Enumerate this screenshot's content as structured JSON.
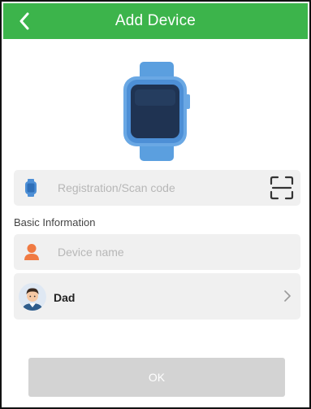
{
  "header": {
    "title": "Add Device",
    "back_icon": "chevron-left-icon",
    "color": "#3cb44b"
  },
  "illustration": {
    "icon": "smartwatch-icon"
  },
  "registration": {
    "placeholder": "Registration/Scan code",
    "value": "",
    "scan_icon": "scan-frame-icon",
    "watch_icon": "watch-icon"
  },
  "basic_info": {
    "label": "Basic Information",
    "device_name": {
      "placeholder": "Device name",
      "value": "",
      "icon": "person-icon"
    },
    "relation": {
      "name": "Dad",
      "avatar_icon": "avatar-icon",
      "chevron_icon": "chevron-right-icon"
    }
  },
  "ok_button": {
    "label": "OK",
    "disabled": true,
    "color": "#d3d3d3"
  }
}
